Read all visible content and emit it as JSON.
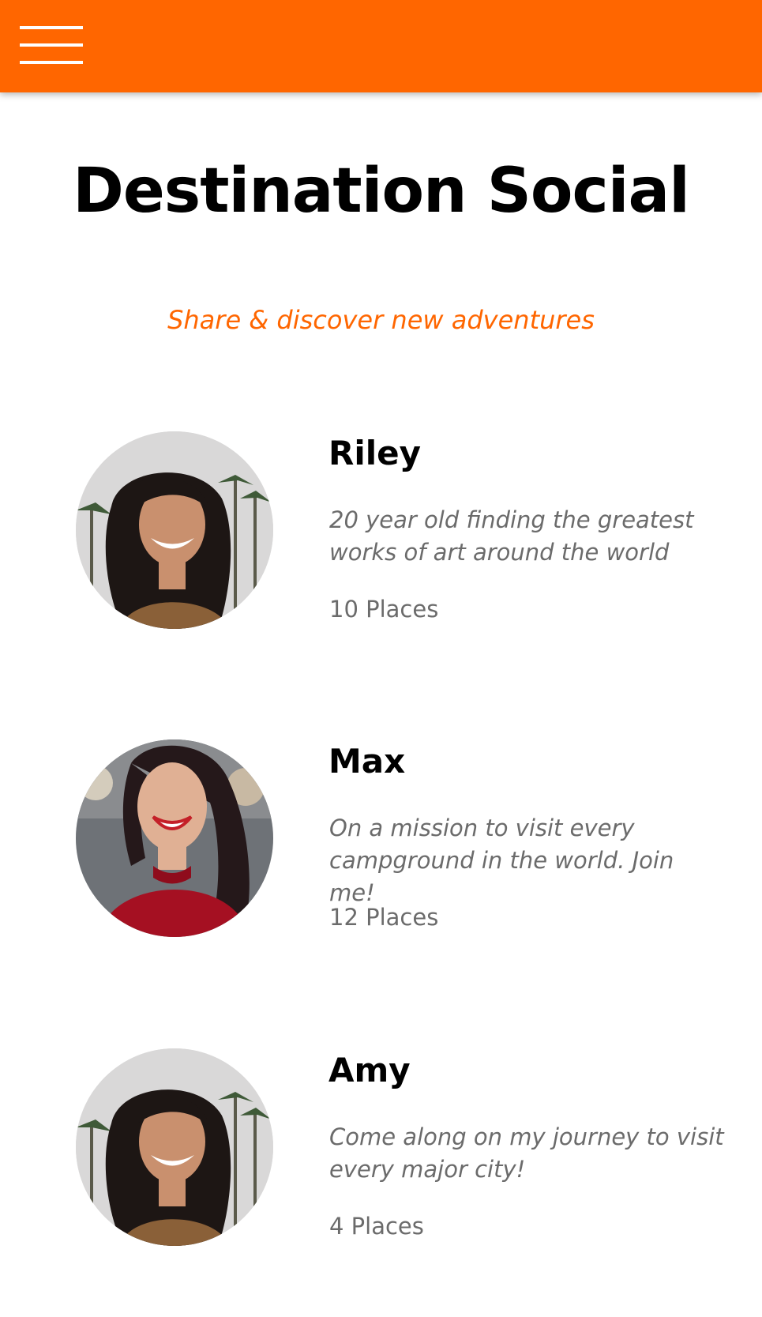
{
  "header": {
    "menu_icon": "hamburger-menu-icon",
    "background_color": "#ff6600"
  },
  "page": {
    "title": "Destination Social",
    "tagline": "Share & discover new adventures",
    "accent_color": "#ff6600"
  },
  "profiles": [
    {
      "name": "Riley",
      "bio": "20 year old finding the greatest works of art around the world",
      "places": "10 Places",
      "avatar_alt": "Riley"
    },
    {
      "name": "Max",
      "bio": "On a mission to visit every campground in the world. Join me!",
      "places": "12 Places",
      "avatar_alt": "Max"
    },
    {
      "name": "Amy",
      "bio": "Come along on my journey to visit every major city!",
      "places": "4 Places",
      "avatar_alt": "Amy"
    }
  ]
}
